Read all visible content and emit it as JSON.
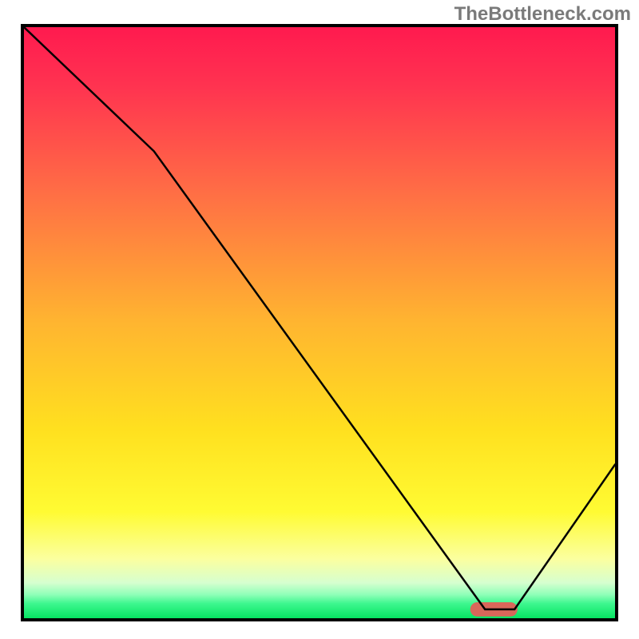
{
  "watermark": "TheBottleneck.com",
  "frame": {
    "inner_w": 740,
    "inner_h": 740
  },
  "chart_data": {
    "type": "line",
    "title": "",
    "xlabel": "",
    "ylabel": "",
    "xlim": [
      0,
      100
    ],
    "ylim": [
      0,
      100
    ],
    "series": [
      {
        "name": "bottleneck-curve",
        "x": [
          0,
          22,
          78,
          83,
          100
        ],
        "values": [
          100,
          79,
          1.5,
          1.5,
          26
        ]
      }
    ],
    "marker": {
      "name": "optimal-range",
      "x0": 75.5,
      "x1": 83.5,
      "y": 1.5,
      "height": 2.4
    },
    "gradient_stops": [
      {
        "offset": 0.0,
        "color": "#ff1a4f"
      },
      {
        "offset": 0.1,
        "color": "#ff3350"
      },
      {
        "offset": 0.28,
        "color": "#ff6e45"
      },
      {
        "offset": 0.5,
        "color": "#ffb530"
      },
      {
        "offset": 0.68,
        "color": "#ffe01f"
      },
      {
        "offset": 0.82,
        "color": "#fffb33"
      },
      {
        "offset": 0.9,
        "color": "#fbffa0"
      },
      {
        "offset": 0.94,
        "color": "#d6ffcf"
      },
      {
        "offset": 0.96,
        "color": "#8fffb8"
      },
      {
        "offset": 0.975,
        "color": "#3ef78f"
      },
      {
        "offset": 1.0,
        "color": "#06e462"
      }
    ]
  }
}
